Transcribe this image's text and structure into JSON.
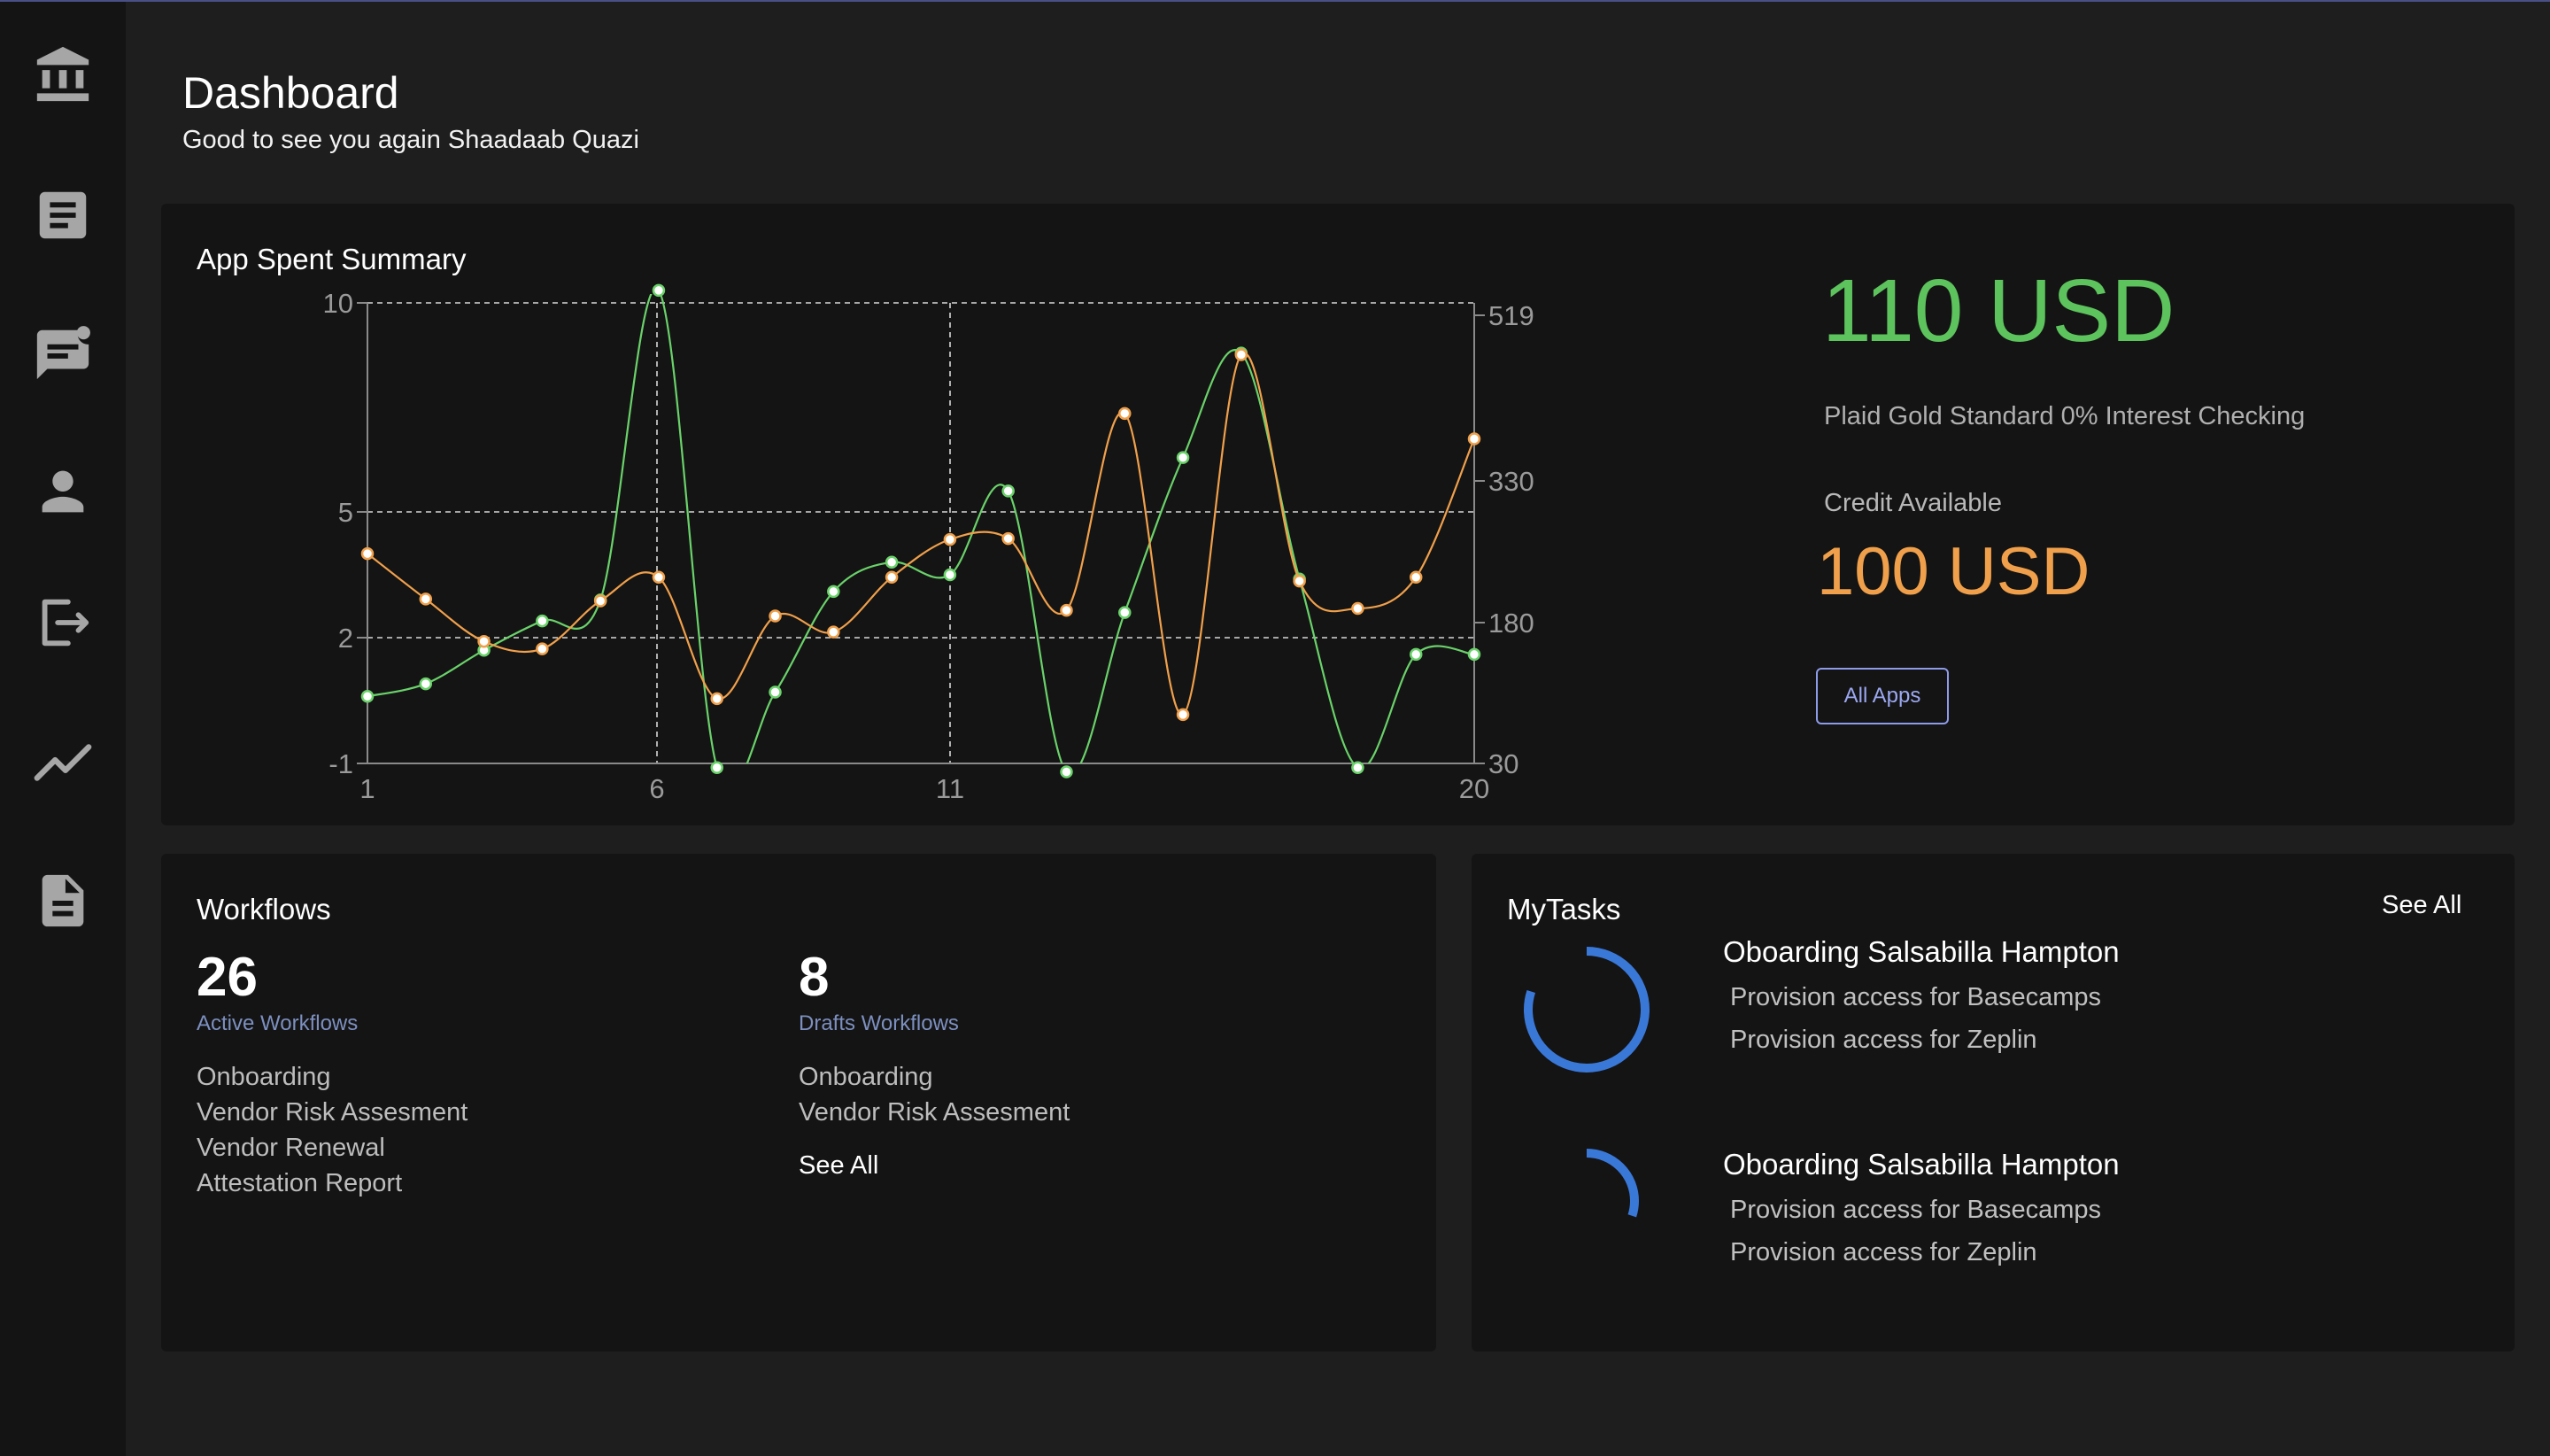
{
  "sidebar": {
    "items": [
      {
        "icon": "bank-icon"
      },
      {
        "icon": "document-icon"
      },
      {
        "icon": "feedback-icon"
      },
      {
        "icon": "person-icon"
      },
      {
        "icon": "logout-icon"
      },
      {
        "icon": "trending-icon"
      },
      {
        "icon": "file-icon"
      }
    ]
  },
  "header": {
    "title": "Dashboard",
    "subtitle": "Good to see you again Shaadaab Quazi"
  },
  "summary": {
    "title": "App Spent Summary",
    "amount": "110 USD",
    "account": "Plaid Gold Standard 0% Interest Checking",
    "credit_label": "Credit Available",
    "credit_amount": "100 USD",
    "button_label": "All Apps"
  },
  "chart_data": {
    "type": "line",
    "title": "App Spent Summary",
    "x": [
      1,
      2,
      3,
      4,
      5,
      6,
      7,
      8,
      9,
      10,
      11,
      12,
      13,
      14,
      15,
      16,
      17,
      18,
      19,
      20
    ],
    "x_ticks": [
      "1",
      "6",
      "11",
      "20"
    ],
    "y_left_ticks": [
      "10",
      "5",
      "2",
      "-1"
    ],
    "y_right_ticks": [
      "519",
      "330",
      "180",
      "30"
    ],
    "grid": "dashed",
    "series": [
      {
        "color": "#6ad26a",
        "axis": "left",
        "values": [
          0.6,
          0.9,
          1.7,
          2.4,
          2.9,
          10.3,
          -1.1,
          0.7,
          3.1,
          3.8,
          3.5,
          5.5,
          -1.2,
          2.6,
          6.3,
          8.8,
          3.4,
          -1.1,
          1.6,
          1.6
        ]
      },
      {
        "color": "#f0a04b",
        "axis": "right",
        "values": [
          253,
          205,
          160,
          152,
          203,
          228,
          99,
          187,
          170,
          228,
          268,
          269,
          193,
          407,
          82,
          474,
          224,
          195,
          228,
          378
        ]
      }
    ]
  },
  "workflows": {
    "title": "Workflows",
    "active": {
      "count": "26",
      "label": "Active Workflows",
      "items": [
        "Onboarding",
        "Vendor Risk Assesment",
        "Vendor Renewal",
        "Attestation Report"
      ]
    },
    "drafts": {
      "count": "8",
      "label": "Drafts Workflows",
      "items": [
        "Onboarding",
        "Vendor Risk Assesment"
      ]
    },
    "see_all": "See All"
  },
  "tasks": {
    "title": "MyTasks",
    "see_all": "See All",
    "items": [
      {
        "title": "Oboarding Salsabilla Hampton",
        "lines": [
          "Provision access for Basecamps",
          "Provision access for Zeplin"
        ],
        "progress": 0.8
      },
      {
        "title": "Oboarding Salsabilla Hampton",
        "lines": [
          "Provision access for Basecamps",
          "Provision access for Zeplin"
        ],
        "progress": 0.3
      }
    ],
    "ring_color": "#3a78d8"
  }
}
